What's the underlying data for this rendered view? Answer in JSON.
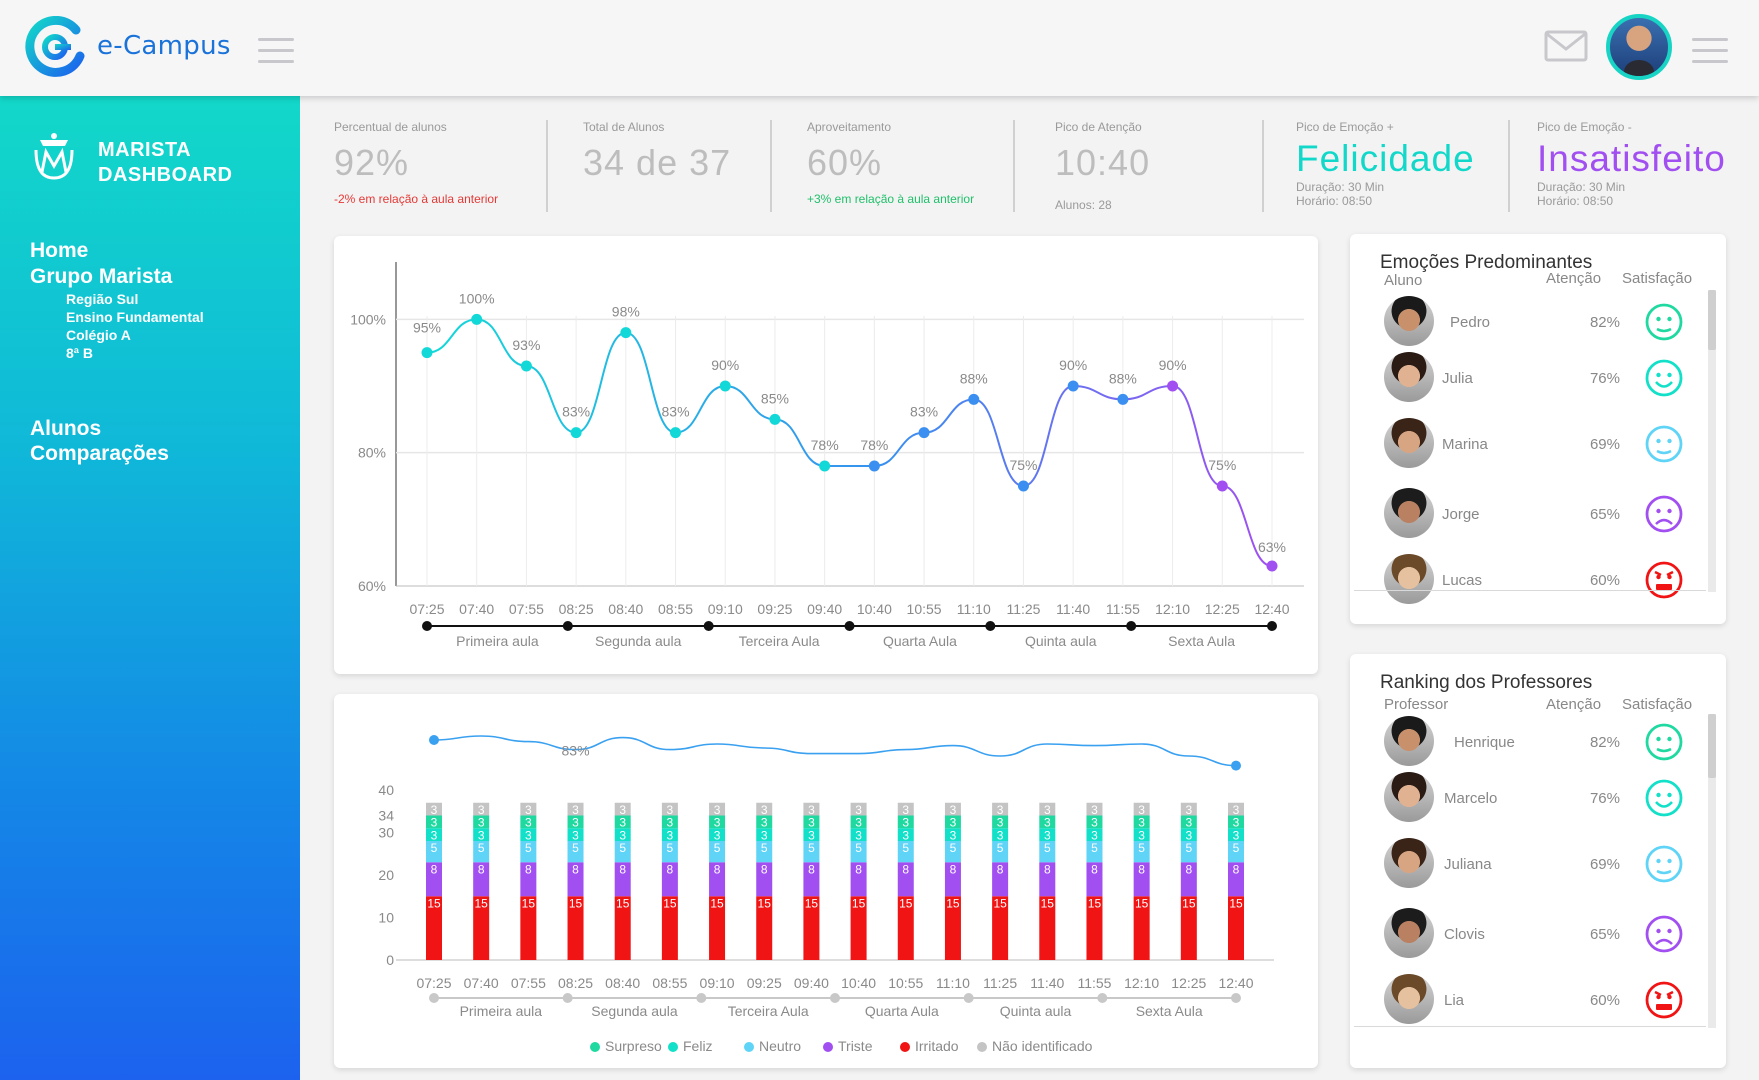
{
  "header": {
    "logo_text": "e-Campus",
    "icons": [
      "menu-icon",
      "mail-icon",
      "avatar",
      "menu-icon"
    ]
  },
  "sidebar": {
    "brand_line1": "MARISTA",
    "brand_line2": "DASHBOARD",
    "nav": {
      "home": "Home",
      "grupo": "Grupo Marista",
      "regiao": "Região Sul",
      "ensino": "Ensino Fundamental",
      "colegio": "Colégio A",
      "turma": "8ª B",
      "alunos": "Alunos",
      "comparacoes": "Comparações"
    }
  },
  "kpis": [
    {
      "label": "Percentual de alunos",
      "value": "92%",
      "note": "-2% em relação à aula anterior",
      "note_color": "#e53935"
    },
    {
      "label": "Total de Alunos",
      "value": "34 de 37"
    },
    {
      "label": "Aproveitamento",
      "value": "60%",
      "note": "+3% em relação à aula anterior",
      "note_color": "#20c06a"
    },
    {
      "label": "Pico de Atenção",
      "value": "10:40",
      "sub": "Alunos: 28"
    },
    {
      "label": "Pico de Emoção +",
      "value": "Felicidade",
      "sub1": "Duração: 30 Min",
      "sub2": "Horário: 08:50",
      "value_color": "#12d8c9"
    },
    {
      "label": "Pico de Emoção -",
      "value": "Insatisfeito",
      "sub1": "Duração: 30 Min",
      "sub2": "Horário: 08:50",
      "value_color": "#a14ff0"
    }
  ],
  "chart_data": [
    {
      "type": "line",
      "x": [
        "07:25",
        "07:40",
        "07:55",
        "08:25",
        "08:40",
        "08:55",
        "09:10",
        "09:25",
        "09:40",
        "10:40",
        "10:55",
        "11:10",
        "11:25",
        "11:40",
        "11:55",
        "12:10",
        "12:25",
        "12:40"
      ],
      "values": [
        95,
        100,
        93,
        83,
        98,
        83,
        90,
        85,
        78,
        78,
        83,
        88,
        75,
        90,
        88,
        90,
        75,
        63
      ],
      "labels": [
        "95%",
        "100%",
        "93%",
        "83%",
        "98%",
        "83%",
        "90%",
        "85%",
        "78%",
        "78%",
        "83%",
        "88%",
        "75%",
        "90%",
        "88%",
        "90%",
        "75%",
        "63%"
      ],
      "yticks": [
        "100%",
        "80%",
        "60%"
      ],
      "ylim": [
        60,
        105
      ],
      "segments": [
        "Primeira aula",
        "Segunda aula",
        "Terceira Aula",
        "Quarta Aula",
        "Quinta aula",
        "Sexta Aula"
      ],
      "colors": {
        "start": "#12d8d8",
        "mid": "#3a8ff0",
        "end": "#a14ff0"
      }
    },
    {
      "type": "bar",
      "stacked": true,
      "x": [
        "07:25",
        "07:40",
        "07:55",
        "08:25",
        "08:40",
        "08:55",
        "09:10",
        "09:25",
        "09:40",
        "10:40",
        "10:55",
        "11:10",
        "11:25",
        "11:40",
        "11:55",
        "12:10",
        "12:25",
        "12:40"
      ],
      "series": [
        {
          "name": "Irritado",
          "value": 15,
          "color": "#f01414"
        },
        {
          "name": "Triste",
          "value": 8,
          "color": "#a14ff0"
        },
        {
          "name": "Neutro",
          "value": 5,
          "color": "#5fd4f6"
        },
        {
          "name": "Feliz",
          "value": 3,
          "color": "#12e0c8"
        },
        {
          "name": "Surpreso",
          "value": 3,
          "color": "#1fd9a0"
        },
        {
          "name": "Não identificado",
          "value": 3,
          "color": "#c4c4c4"
        }
      ],
      "yticks": [
        "40",
        "34",
        "30",
        "20",
        "10",
        "0"
      ],
      "ylim": [
        0,
        40
      ],
      "overlay_label": "83%",
      "segments": [
        "Primeira aula",
        "Segunda aula",
        "Terceira Aula",
        "Quarta Aula",
        "Quinta aula",
        "Sexta Aula"
      ],
      "legend": [
        "Surpreso",
        "Feliz",
        "Neutro",
        "Triste",
        "Irritado",
        "Não identificado"
      ]
    }
  ],
  "emotions_panel": {
    "title": "Emoções Predominantes",
    "col_name": "Aluno",
    "col_att": "Atenção",
    "col_sat": "Satisfação",
    "rows": [
      {
        "name": "Pedro",
        "pct": "82%",
        "emotion": "neutral-face-icon",
        "color": "#1fd9a0"
      },
      {
        "name": "Julia",
        "pct": "76%",
        "emotion": "smile-face-icon",
        "color": "#12e0c8"
      },
      {
        "name": "Marina",
        "pct": "69%",
        "emotion": "neutral-face-icon",
        "color": "#5fd4f6"
      },
      {
        "name": "Jorge",
        "pct": "65%",
        "emotion": "sad-face-icon",
        "color": "#a14ff0"
      },
      {
        "name": "Lucas",
        "pct": "60%",
        "emotion": "angry-face-icon",
        "color": "#f01414"
      }
    ]
  },
  "teachers_panel": {
    "title": "Ranking dos Professores",
    "col_name": "Professor",
    "col_att": "Atenção",
    "col_sat": "Satisfação",
    "rows": [
      {
        "name": "Henrique",
        "pct": "82%",
        "emotion": "neutral-face-icon",
        "color": "#1fd9a0"
      },
      {
        "name": "Marcelo",
        "pct": "76%",
        "emotion": "smile-face-icon",
        "color": "#12e0c8"
      },
      {
        "name": "Juliana",
        "pct": "69%",
        "emotion": "neutral-face-icon",
        "color": "#5fd4f6"
      },
      {
        "name": "Clovis",
        "pct": "65%",
        "emotion": "sad-face-icon",
        "color": "#a14ff0"
      },
      {
        "name": "Lia",
        "pct": "60%",
        "emotion": "angry-face-icon",
        "color": "#f01414"
      }
    ]
  }
}
